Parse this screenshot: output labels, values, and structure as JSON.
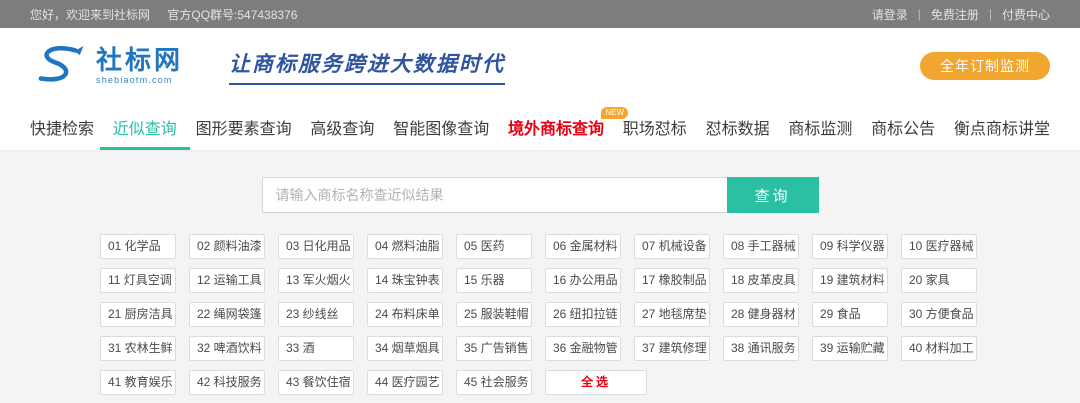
{
  "topbar": {
    "greeting": "您好，欢迎来到社标网",
    "qq": "官方QQ群号:547438376",
    "divider": "|",
    "links": [
      {
        "name": "login-link",
        "label": "请登录"
      },
      {
        "name": "register-link",
        "label": "免费注册"
      },
      {
        "name": "pay-center-link",
        "label": "付费中心"
      }
    ]
  },
  "header": {
    "logo_name": "社标网",
    "logo_domain": "shebiaotm.com",
    "slogan": "让商标服务跨进大数据时代",
    "cta_label": "全年订制监测"
  },
  "nav": {
    "items": [
      {
        "name": "nav-quick-search",
        "label": "快捷检索",
        "active": false
      },
      {
        "name": "nav-similar-search",
        "label": "近似查询",
        "active": true
      },
      {
        "name": "nav-figurative-element-search",
        "label": "图形要素查询",
        "active": false
      },
      {
        "name": "nav-advanced-search",
        "label": "高级查询",
        "active": false
      },
      {
        "name": "nav-smart-image-search",
        "label": "智能图像查询",
        "active": false
      },
      {
        "name": "nav-overseas-trademark-search",
        "label": "境外商标查询",
        "active": false,
        "hot": true,
        "badge": "NEW"
      },
      {
        "name": "nav-workplace-duibiao",
        "label": "职场怼标",
        "active": false
      },
      {
        "name": "nav-duibiao-data",
        "label": "怼标数据",
        "active": false
      },
      {
        "name": "nav-trademark-monitor",
        "label": "商标监测",
        "active": false
      },
      {
        "name": "nav-trademark-gazette",
        "label": "商标公告",
        "active": false
      },
      {
        "name": "nav-trademark-lecture",
        "label": "衡点商标讲堂",
        "active": false
      }
    ]
  },
  "search": {
    "placeholder": "请输入商标名称查近似结果",
    "button_label": "查询"
  },
  "categories": {
    "items": [
      "01 化学品",
      "02 颜料油漆",
      "03 日化用品",
      "04 燃料油脂",
      "05 医药",
      "06 金属材料",
      "07 机械设备",
      "08 手工器械",
      "09 科学仪器",
      "10 医疗器械",
      "11 灯具空调",
      "12 运输工具",
      "13 军火烟火",
      "14 珠宝钟表",
      "15 乐器",
      "16 办公用品",
      "17 橡胶制品",
      "18 皮革皮具",
      "19 建筑材料",
      "20 家具",
      "21 厨房洁具",
      "22 绳网袋篷",
      "23 纱线丝",
      "24 布料床单",
      "25 服装鞋帽",
      "26 纽扣拉链",
      "27 地毯席垫",
      "28 健身器材",
      "29 食品",
      "30 方便食品",
      "31 农林生鲜",
      "32 啤酒饮料",
      "33 酒",
      "34 烟草烟具",
      "35 广告销售",
      "36 金融物管",
      "37 建筑修理",
      "38 通讯服务",
      "39 运输贮藏",
      "40 材料加工",
      "41 教育娱乐",
      "42 科技服务",
      "43 餐饮住宿",
      "44 医疗园艺",
      "45 社会服务"
    ],
    "select_all": "全选"
  },
  "colors": {
    "accent_teal": "#2bc0a4",
    "accent_orange": "#f0a62f",
    "accent_red": "#e60012",
    "topbar_gray": "#7d7d7d",
    "logo_blue": "#2176c0"
  }
}
